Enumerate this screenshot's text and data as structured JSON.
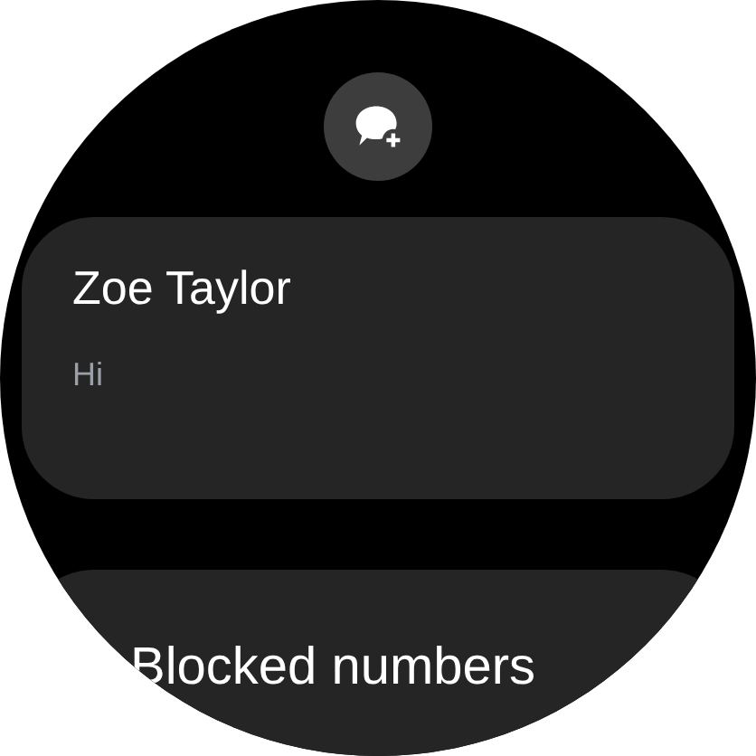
{
  "conversations": [
    {
      "name": "Zoe Taylor",
      "preview": "Hi"
    }
  ],
  "menu_items": [
    {
      "label": "Blocked numbers"
    }
  ]
}
